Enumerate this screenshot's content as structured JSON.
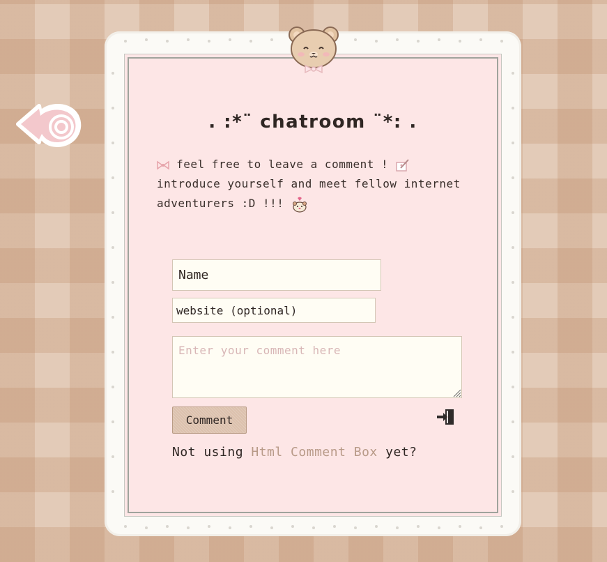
{
  "page": {
    "title": ". :*¨ chatroom ¨*: .",
    "intro_line1": "feel free to leave a comment ! ",
    "intro_line2": "introduce yourself and meet fellow internet",
    "intro_line3": "adventurers :D !!! "
  },
  "form": {
    "name_value": "Name",
    "website_value": "website (optional)",
    "comment_placeholder": "Enter your comment here",
    "submit_label": "Comment"
  },
  "footer": {
    "prefix": "Not using ",
    "link_text": "Html Comment Box",
    "suffix": "  yet?"
  },
  "icons": {
    "back": "swirl-arrow-back-icon",
    "bear": "teddy-bear-head-icon",
    "bow": "pink-bow-icon",
    "notebook": "notebook-pencil-icon",
    "hamster": "hamster-heart-icon",
    "login": "login-door-icon"
  },
  "colors": {
    "background": "#e3cbb8",
    "panel": "#fde6e6",
    "lace": "#fbfaf6",
    "input_bg": "#fffdf4",
    "button_bg": "#dcc1ad",
    "link": "#b89a88",
    "accent_pink": "#e6b8bc"
  }
}
